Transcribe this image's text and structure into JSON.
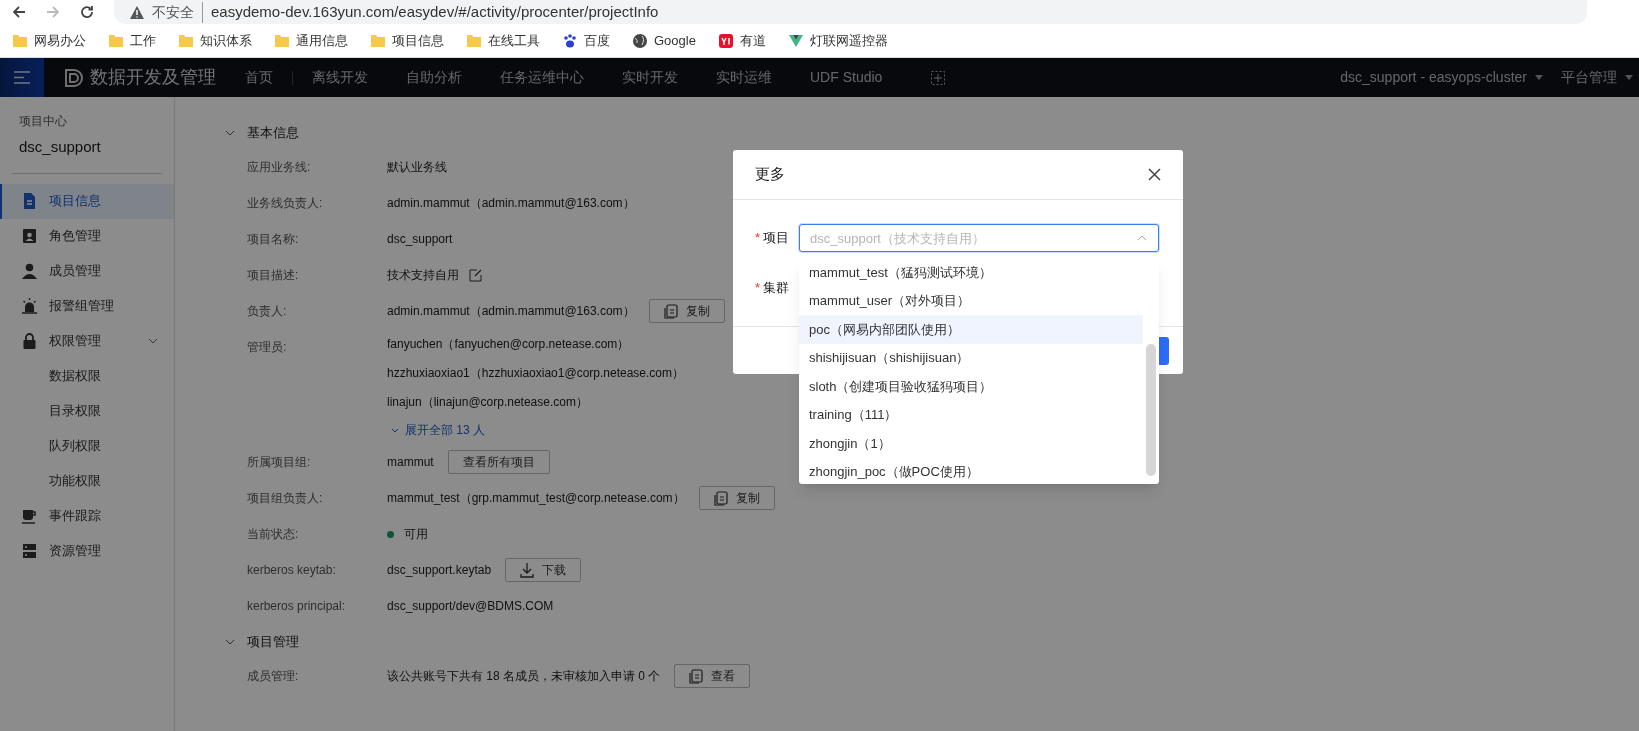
{
  "browser": {
    "security": "不安全",
    "url": "easydemo-dev.163yun.com/easydev/#/activity/procenter/projectInfo",
    "bookmarks": [
      {
        "label": "网易办公",
        "kind": "folder"
      },
      {
        "label": "工作",
        "kind": "folder"
      },
      {
        "label": "知识体系",
        "kind": "folder"
      },
      {
        "label": "通用信息",
        "kind": "folder"
      },
      {
        "label": "项目信息",
        "kind": "folder"
      },
      {
        "label": "在线工具",
        "kind": "folder"
      },
      {
        "label": "百度",
        "kind": "paw"
      },
      {
        "label": "Google",
        "kind": "globe"
      },
      {
        "label": "有道",
        "kind": "yd"
      },
      {
        "label": "灯联网遥控器",
        "kind": "vee"
      }
    ]
  },
  "app_nav": {
    "title": "数据开发及管理",
    "items": [
      "首页",
      "离线开发",
      "自助分析",
      "任务运维中心",
      "实时开发",
      "实时运维",
      "UDF Studio"
    ],
    "cluster": "dsc_support - easyops-cluster",
    "menu": "平台管理"
  },
  "sidebar": {
    "heading": "项目中心",
    "project": "dsc_support",
    "items": [
      {
        "label": "项目信息",
        "kind": "doc",
        "selected": true
      },
      {
        "label": "角色管理",
        "kind": "badge",
        "selected": false
      },
      {
        "label": "成员管理",
        "kind": "person",
        "selected": false
      },
      {
        "label": "报警组管理",
        "kind": "alarm",
        "selected": false
      },
      {
        "label": "权限管理",
        "kind": "lock",
        "selected": false,
        "expanded": true,
        "children": [
          {
            "label": "数据权限",
            "selected": false
          },
          {
            "label": "目录权限",
            "selected": false
          },
          {
            "label": "队列权限",
            "selected": false
          },
          {
            "label": "功能权限",
            "selected": false
          }
        ]
      },
      {
        "label": "事件跟踪",
        "kind": "cup",
        "selected": false
      },
      {
        "label": "资源管理",
        "kind": "server",
        "selected": false
      }
    ]
  },
  "sections": [
    {
      "title": "基本信息",
      "expanded": true,
      "rows": [
        {
          "label": "应用业务线:",
          "values": [
            "默认业务线"
          ]
        },
        {
          "label": "业务线负责人:",
          "values": [
            "admin.mammut（admin.mammut@163.com）"
          ]
        },
        {
          "label": "项目名称:",
          "values": [
            "dsc_support"
          ]
        },
        {
          "label": "项目描述:",
          "values": [
            "技术支持自用"
          ],
          "editable": true
        },
        {
          "label": "负责人:",
          "values": [
            "admin.mammut（admin.mammut@163.com）"
          ],
          "action": {
            "label": "复制",
            "kind": "copy"
          }
        },
        {
          "label": "管理员:",
          "values": [
            "fanyuchen（fanyuchen@corp.netease.com）",
            "hzzhuxiaoxiao1（hzzhuxiaoxiao1@corp.netease.com）",
            "linajun（linajun@corp.netease.com）"
          ],
          "expand_link": "展开全部 13 人"
        },
        {
          "label": "所属项目组:",
          "values": [
            "mammut"
          ],
          "action": {
            "label": "查看所有项目",
            "kind": "plain"
          }
        },
        {
          "label": "项目组负责人:",
          "values": [
            "mammut_test（grp.mammut_test@corp.netease.com）"
          ],
          "action": {
            "label": "复制",
            "kind": "copy"
          }
        },
        {
          "label": "当前状态:",
          "values": [
            "可用"
          ],
          "kind": "status"
        },
        {
          "label": "kerberos keytab:",
          "values": [
            "dsc_support.keytab"
          ],
          "action": {
            "label": "下载",
            "kind": "download"
          }
        },
        {
          "label": "kerberos principal:",
          "values": [
            "dsc_support/dev@BDMS.COM"
          ]
        }
      ]
    },
    {
      "title": "项目管理",
      "expanded": true,
      "rows": [
        {
          "label": "成员管理:",
          "values": [
            "该公共账号下共有 18 名成员，未审核加入申请 0 个"
          ],
          "action": {
            "label": "查看",
            "kind": "copy"
          }
        }
      ]
    }
  ],
  "modal": {
    "title": "更多",
    "fields": [
      {
        "label": "项目",
        "required_mark": "*",
        "placeholder": "dsc_support（技术支持自用）",
        "open": true
      },
      {
        "label": "集群",
        "required_mark": "*"
      }
    ],
    "options": [
      {
        "label": "mammut_test（猛犸测试环境）",
        "highlighted": false
      },
      {
        "label": "mammut_user（对外项目）",
        "highlighted": false
      },
      {
        "label": "poc（网易内部团队使用）",
        "highlighted": true
      },
      {
        "label": "shishijisuan（shishijisuan）",
        "highlighted": false
      },
      {
        "label": "sloth（创建项目验收猛犸项目）",
        "highlighted": false
      },
      {
        "label": "training（111）",
        "highlighted": false
      },
      {
        "label": "zhongjin（1）",
        "highlighted": false
      },
      {
        "label": "zhongjin_poc（做POC使用）",
        "highlighted": false
      }
    ]
  }
}
